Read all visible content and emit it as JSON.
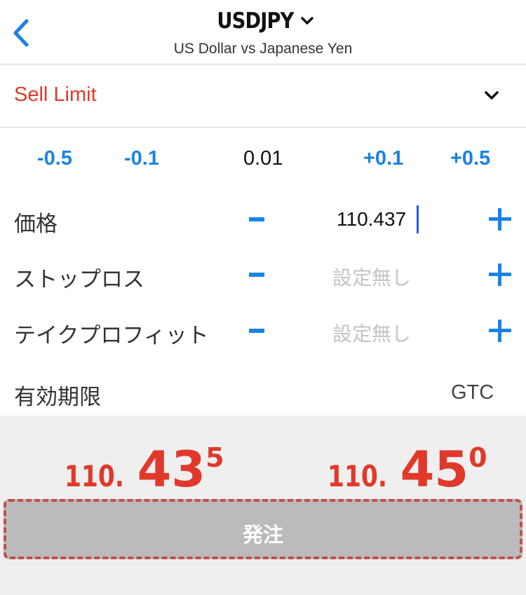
{
  "header": {
    "symbol": "USDJPY",
    "subtitle": "US Dollar vs Japanese Yen",
    "back_icon": "chevron-left-icon",
    "symbol_chevron_icon": "chevron-down-icon"
  },
  "order_type": {
    "label": "Sell Limit",
    "color": "#e0392b",
    "chevron_icon": "chevron-down-icon"
  },
  "step": {
    "buttons": [
      "-0.5",
      "-0.1",
      "+0.1",
      "+0.5"
    ],
    "value": "0.01"
  },
  "fields": {
    "price": {
      "label": "価格",
      "value": "110.437"
    },
    "stop_loss": {
      "label": "ストップロス",
      "placeholder": "設定無し"
    },
    "take_profit": {
      "label": "テイクプロフィット",
      "placeholder": "設定無し"
    }
  },
  "expiry": {
    "label": "有効期限",
    "value": "GTC"
  },
  "quotes": {
    "bid": {
      "prefix": "110.",
      "big": "43",
      "sup": "5"
    },
    "ask": {
      "prefix": "110.",
      "big": "45",
      "sup": "0"
    }
  },
  "order_button": {
    "label": "発注"
  },
  "colors": {
    "accent": "#1a82e2",
    "sell": "#e0392b",
    "placeholder": "#c4c4c4",
    "quote_bg": "#efefef",
    "button_bg": "#bbbbbb"
  }
}
